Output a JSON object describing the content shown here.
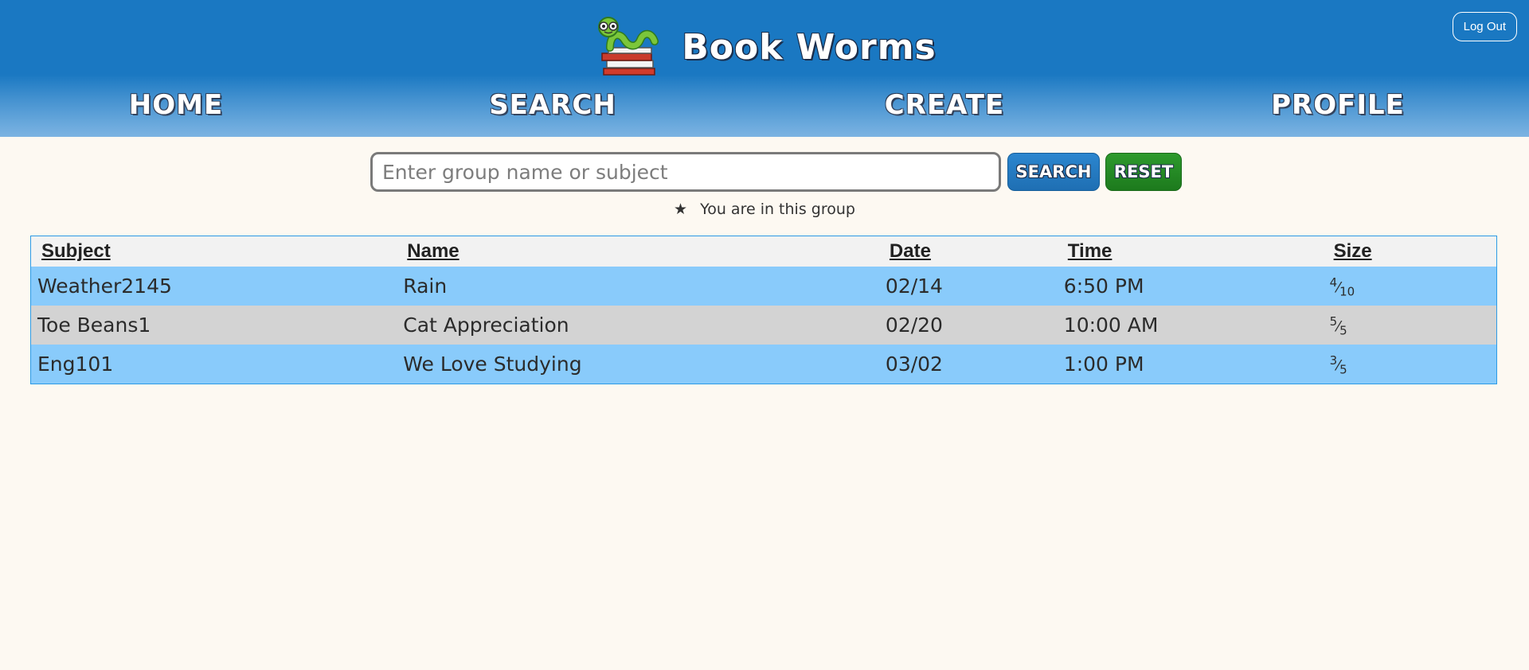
{
  "header": {
    "title": "Book Worms",
    "logo_icon": "bookworm-logo-icon",
    "logout_label": "Log Out",
    "colors": {
      "header_blue": "#1a78c2",
      "page_bg": "#fdf9f2"
    }
  },
  "nav": {
    "home": "HOME",
    "search": "SEARCH",
    "create": "CREATE",
    "profile": "PROFILE"
  },
  "search": {
    "placeholder": "Enter group name or subject",
    "value": "",
    "search_label": "SEARCH",
    "reset_label": "RESET",
    "colors": {
      "search_button": "#1f6fb3",
      "reset_button": "#2d9a2d"
    }
  },
  "legend": {
    "star": "★",
    "text": "You are in this group"
  },
  "table": {
    "headers": {
      "subject": "Subject",
      "name": "Name",
      "date": "Date",
      "time": "Time",
      "size": "Size"
    },
    "rows": [
      {
        "subject": "Weather2145",
        "name": "Rain",
        "date": "02/14",
        "time": "6:50 PM",
        "size_current": "4",
        "size_max": "10"
      },
      {
        "subject": "Toe Beans1",
        "name": "Cat Appreciation",
        "date": "02/20",
        "time": "10:00 AM",
        "size_current": "5",
        "size_max": "5"
      },
      {
        "subject": "Eng101",
        "name": "We Love Studying",
        "date": "03/02",
        "time": "1:00 PM",
        "size_current": "3",
        "size_max": "5"
      }
    ],
    "colors": {
      "row_blue": "#89cbfb",
      "row_gray": "#d3d3d3",
      "border": "#2c9be6"
    }
  }
}
